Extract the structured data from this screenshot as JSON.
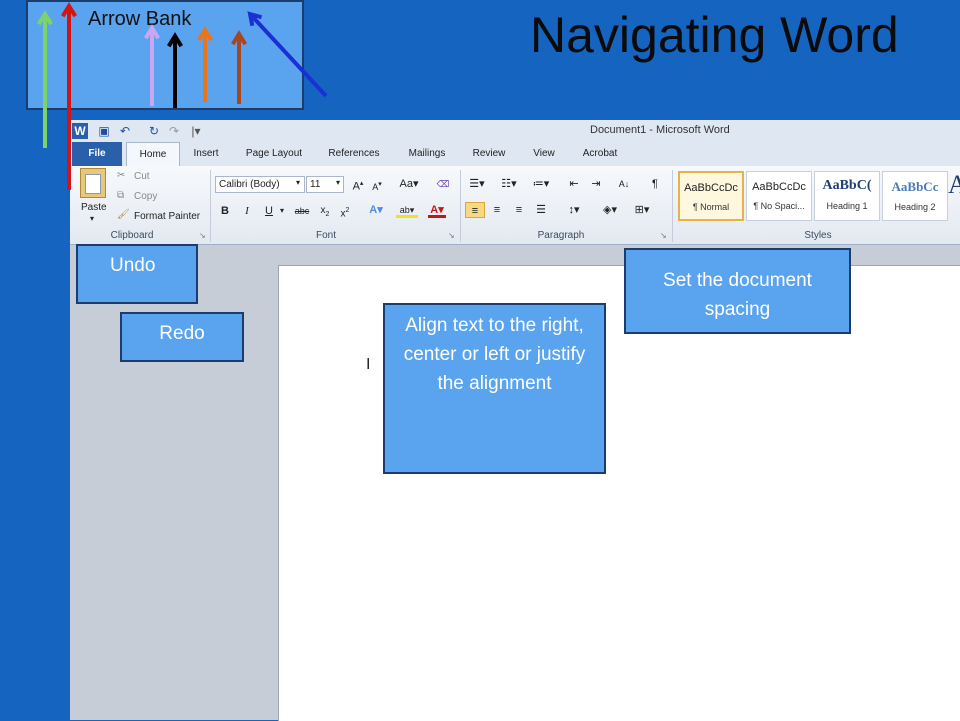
{
  "slide_title": "Navigating Word",
  "arrow_bank": {
    "label": "Arrow Bank",
    "arrows": [
      {
        "name": "green-arrow",
        "color": "#7bd36b"
      },
      {
        "name": "red-arrow",
        "color": "#d41414"
      },
      {
        "name": "lavender-arrow",
        "color": "#c9a7f2"
      },
      {
        "name": "black-arrow",
        "color": "#000000"
      },
      {
        "name": "orange-arrow",
        "color": "#e8751a"
      },
      {
        "name": "brown-arrow",
        "color": "#a8461f"
      },
      {
        "name": "blue-arrow",
        "color": "#1a2fd6"
      }
    ]
  },
  "word": {
    "window_title": "Document1  -  Microsoft Word",
    "tabs": [
      "File",
      "Home",
      "Insert",
      "Page Layout",
      "References",
      "Mailings",
      "Review",
      "View",
      "Acrobat"
    ],
    "clipboard": {
      "paste": "Paste",
      "cut": "Cut",
      "copy": "Copy",
      "format_painter": "Format Painter",
      "label": "Clipboard"
    },
    "font": {
      "font_name": "Calibri (Body)",
      "font_size": "11",
      "label": "Font"
    },
    "paragraph": {
      "label": "Paragraph"
    },
    "styles": {
      "label": "Styles",
      "items": [
        {
          "sample": "AaBbCcDc",
          "name": "¶ Normal"
        },
        {
          "sample": "AaBbCcDc",
          "name": "¶ No Spaci..."
        },
        {
          "sample": "AaBbC(",
          "name": "Heading 1"
        },
        {
          "sample": "AaBbCc",
          "name": "Heading 2"
        }
      ]
    },
    "doc_cursor": "I"
  },
  "callouts": {
    "undo": "Undo",
    "redo": "Redo",
    "align": "Align text to the right, center or left or justify the alignment",
    "spacing": "Set the document spacing"
  }
}
